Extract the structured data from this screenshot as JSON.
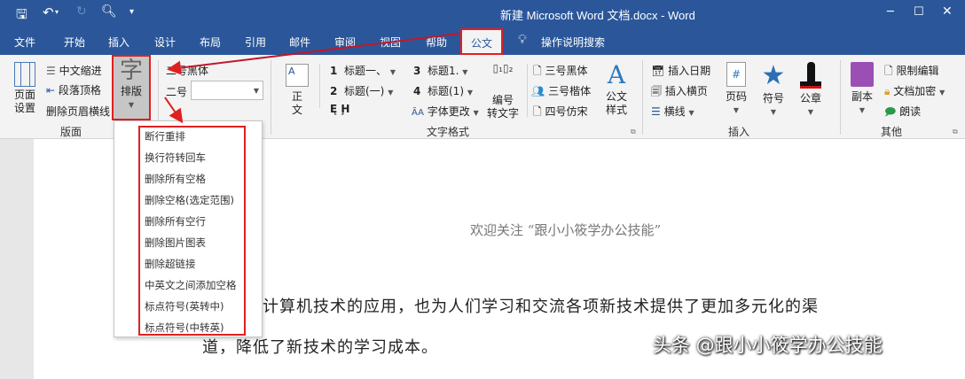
{
  "title": "新建 Microsoft Word 文档.docx  -  Word",
  "qat": {
    "save": "save-icon",
    "undo": "undo-icon",
    "redo": "redo-icon",
    "preview": "print-preview-icon",
    "customize": "▾"
  },
  "tabs": [
    "文件",
    "开始",
    "插入",
    "设计",
    "布局",
    "引用",
    "邮件",
    "审阅",
    "视图",
    "帮助"
  ],
  "active_tab": "公文",
  "tell_me": "操作说明搜索",
  "ribbon": {
    "layout_group": {
      "label": "版面",
      "page_setup": [
        "页面",
        "设置"
      ],
      "items": [
        "中文缩进",
        "段落顶格",
        "删除页眉横线"
      ],
      "typeset_glyph": "字",
      "typeset": "排版"
    },
    "font": {
      "font_name": "二号黑体",
      "size_label": "二号",
      "size_value": ""
    },
    "text_format": {
      "label": "文字格式",
      "body": [
        "正",
        "文"
      ],
      "headings": [
        {
          "num": "1",
          "text": "标题一、"
        },
        {
          "num": "2",
          "text": "标题(一)"
        },
        {
          "num": "3",
          "text": "标题1."
        },
        {
          "num": "4",
          "text": "标题(1)"
        }
      ],
      "eh": "Ę  Ḩ",
      "font_change": "字体更改",
      "numbering": [
        "编号",
        "转文字"
      ],
      "styles": [
        "三号黑体",
        "三号楷体",
        "四号仿宋"
      ],
      "official_style": [
        "公文",
        "样式"
      ]
    },
    "insert": {
      "label": "插入",
      "items": [
        "插入日期",
        "插入横页",
        "横线"
      ],
      "page_num": "页码",
      "symbol": "符号",
      "seal": "公章"
    },
    "other": {
      "label": "其他",
      "copy": "副本",
      "items": [
        "限制编辑",
        "文档加密",
        "朗读"
      ]
    }
  },
  "menu": [
    "断行重排",
    "换行符转回车",
    "删除所有空格",
    "删除空格(选定范围)",
    "删除所有空行",
    "删除图片图表",
    "删除超链接",
    "中英文之间添加空格",
    "标点符号(英转中)",
    "标点符号(中转英)"
  ],
  "doc": {
    "heading": "欢迎关注 “跟小小筱学办公技能”",
    "line1": "时，计算机技术的应用，也为人们学习和交流各项新技术提供了更加多元化的渠",
    "line2": "道，降低了新技术的学习成本。"
  },
  "watermark": "头条 @跟小小筱学办公技能",
  "colors": {
    "brand": "#2b579a",
    "highlight": "#e02020"
  }
}
